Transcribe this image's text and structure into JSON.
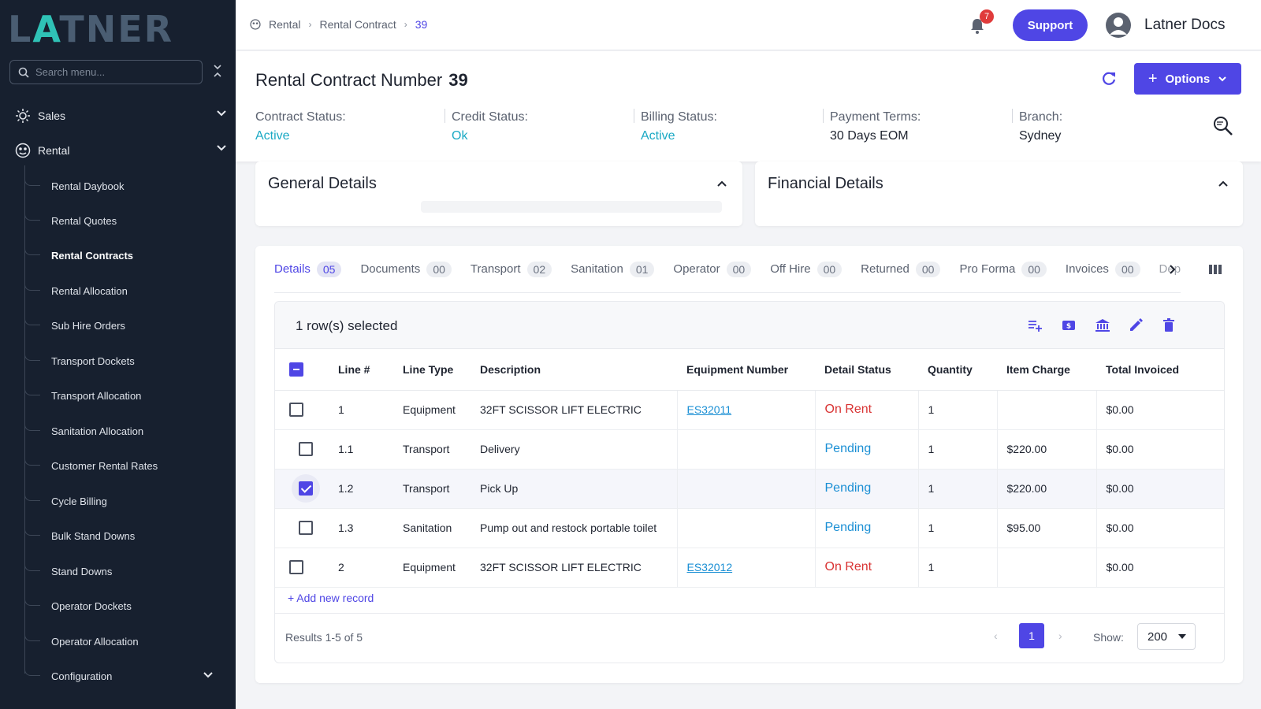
{
  "app": {
    "logo_text_left": "L",
    "logo_text_tri": "A",
    "logo_text_right": "TNER",
    "accent_color": "#4f46e5",
    "sidebar_bg": "#17202f"
  },
  "sidebar": {
    "search_placeholder": "Search menu...",
    "collapse_icon": "chevrons-icon",
    "sections": [
      {
        "label": "Sales",
        "icon": "sales-icon",
        "expanded": false
      },
      {
        "label": "Rental",
        "icon": "rental-icon",
        "expanded": true
      }
    ],
    "items": [
      {
        "label": "Rental Daybook"
      },
      {
        "label": "Rental Quotes"
      },
      {
        "label": "Rental Contracts",
        "active": true
      },
      {
        "label": "Rental Allocation"
      },
      {
        "label": "Sub Hire Orders"
      },
      {
        "label": "Transport Dockets"
      },
      {
        "label": "Transport Allocation"
      },
      {
        "label": "Sanitation Allocation"
      },
      {
        "label": "Customer Rental Rates"
      },
      {
        "label": "Cycle Billing"
      },
      {
        "label": "Bulk Stand Downs"
      },
      {
        "label": "Stand Downs"
      },
      {
        "label": "Operator Dockets"
      },
      {
        "label": "Operator Allocation"
      },
      {
        "label": "Configuration",
        "has_children": true
      }
    ]
  },
  "topbar": {
    "breadcrumb": [
      "Rental",
      "Rental Contract",
      "39"
    ],
    "notification_count": "7",
    "support_label": "Support",
    "user_name": "Latner Docs"
  },
  "header": {
    "title": "Rental Contract Number",
    "number": "39",
    "options_label": "Options",
    "statuses": [
      {
        "label": "Contract Status:",
        "value": "Active"
      },
      {
        "label": "Credit Status:",
        "value": "Ok"
      },
      {
        "label": "Billing Status:",
        "value": "Active"
      },
      {
        "label": "Payment Terms:",
        "value": "30 Days EOM"
      },
      {
        "label": "Branch:",
        "value": "Sydney"
      }
    ]
  },
  "cards": {
    "general_title": "General Details",
    "financial_title": "Financial Details"
  },
  "tabs": [
    {
      "label": "Details",
      "count": "05",
      "active": true
    },
    {
      "label": "Documents",
      "count": "00"
    },
    {
      "label": "Transport",
      "count": "02"
    },
    {
      "label": "Sanitation",
      "count": "01"
    },
    {
      "label": "Operator",
      "count": "00"
    },
    {
      "label": "Off Hire",
      "count": "00"
    },
    {
      "label": "Returned",
      "count": "00"
    },
    {
      "label": "Pro Forma",
      "count": "00"
    },
    {
      "label": "Invoices",
      "count": "00"
    },
    {
      "label": "Dep",
      "count": ""
    }
  ],
  "table": {
    "selection_text": "1 row(s) selected",
    "columns": [
      "Line #",
      "Line Type",
      "Description",
      "Equipment Number",
      "Detail Status",
      "Quantity",
      "Item Charge",
      "Total Invoiced"
    ],
    "rows": [
      {
        "line": "1",
        "type": "Equipment",
        "desc": "32FT SCISSOR LIFT ELECTRIC",
        "equip": "ES32011",
        "status": "On Rent",
        "qty": "1",
        "charge": "",
        "invoiced": "$0.00",
        "checked": false
      },
      {
        "line": "1.1",
        "type": "Transport",
        "desc": "Delivery",
        "equip": "",
        "status": "Pending",
        "qty": "1",
        "charge": "$220.00",
        "invoiced": "$0.00",
        "checked": false
      },
      {
        "line": "1.2",
        "type": "Transport",
        "desc": "Pick Up",
        "equip": "",
        "status": "Pending",
        "qty": "1",
        "charge": "$220.00",
        "invoiced": "$0.00",
        "checked": true
      },
      {
        "line": "1.3",
        "type": "Sanitation",
        "desc": "Pump out and restock portable toilet",
        "equip": "",
        "status": "Pending",
        "qty": "1",
        "charge": "$95.00",
        "invoiced": "$0.00",
        "checked": false
      },
      {
        "line": "2",
        "type": "Equipment",
        "desc": "32FT SCISSOR LIFT ELECTRIC",
        "equip": "ES32012",
        "status": "On Rent",
        "qty": "1",
        "charge": "",
        "invoiced": "$0.00",
        "checked": false
      }
    ],
    "add_record": "+ Add new record",
    "results_text": "Results 1-5 of 5",
    "current_page": "1",
    "show_label": "Show:",
    "page_size": "200"
  }
}
